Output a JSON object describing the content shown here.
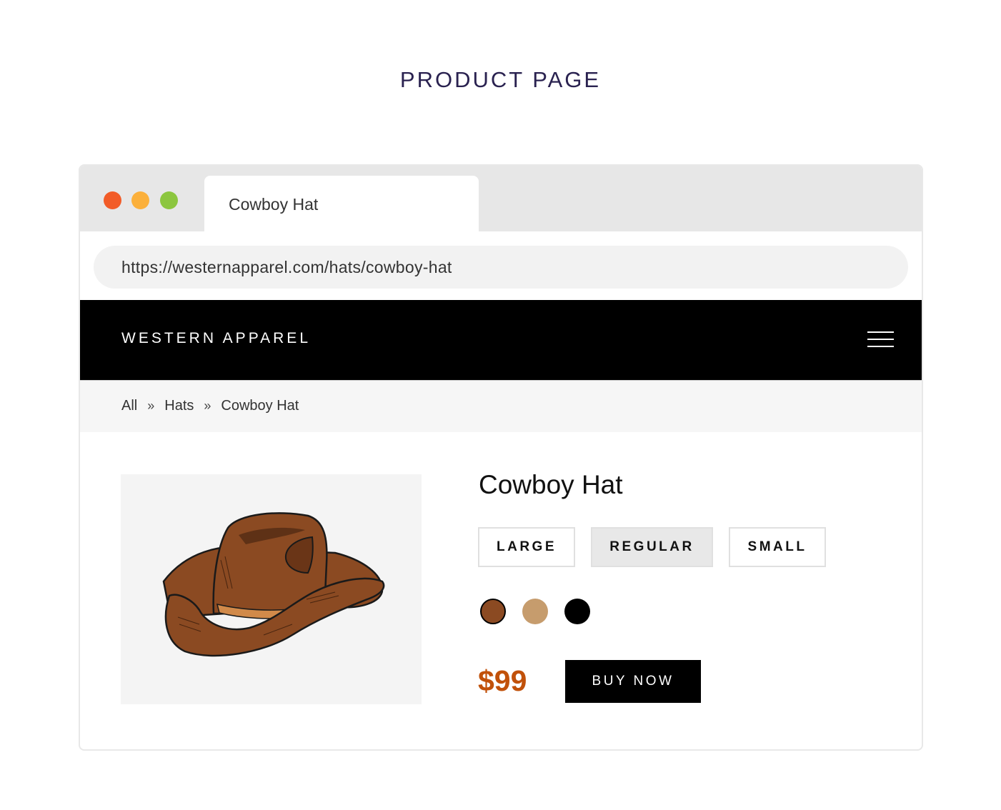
{
  "heading": "PRODUCT PAGE",
  "browser": {
    "window_controls": {
      "close_color": "#f25c28",
      "minimize_color": "#fbb03b",
      "maximize_color": "#8cc63f"
    },
    "tab_title": "Cowboy Hat",
    "url": "https://westernapparel.com/hats/cowboy-hat"
  },
  "site": {
    "brand": "WESTERN APPAREL",
    "menu_icon": "hamburger-menu-icon"
  },
  "breadcrumb": {
    "items": [
      "All",
      "Hats",
      "Cowboy Hat"
    ],
    "separator": "»"
  },
  "product": {
    "title": "Cowboy Hat",
    "image_alt": "cowboy-hat-illustration",
    "sizes": [
      {
        "label": "LARGE",
        "selected": false
      },
      {
        "label": "REGULAR",
        "selected": true
      },
      {
        "label": "SMALL",
        "selected": false
      }
    ],
    "colors": [
      {
        "name": "brown",
        "hex": "#8b4a22",
        "selected": true
      },
      {
        "name": "tan",
        "hex": "#c69c6d",
        "selected": false
      },
      {
        "name": "black",
        "hex": "#000000",
        "selected": false
      }
    ],
    "price": "$99",
    "price_color": "#c1510a",
    "buy_label": "BUY NOW"
  }
}
